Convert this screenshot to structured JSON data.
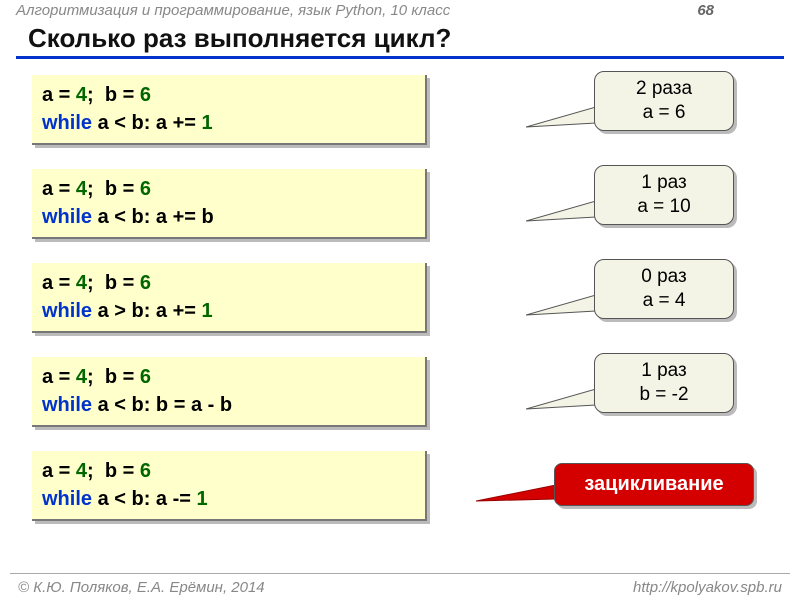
{
  "header": {
    "course": "Алгоритмизация и программирование, язык Python, 10 класс",
    "page": "68"
  },
  "title": "Сколько раз выполняется цикл?",
  "examples": [
    {
      "code": {
        "init_a": "a = ",
        "va": "4",
        "sep": ";  b = ",
        "vb": "6",
        "loop": "while ",
        "cond": "a < b: a += ",
        "tail_num": "1",
        "tail_txt": ""
      },
      "answer": {
        "line1": "2 раза",
        "line2": "a = 6",
        "style": "plain"
      }
    },
    {
      "code": {
        "init_a": "a = ",
        "va": "4",
        "sep": ";  b = ",
        "vb": "6",
        "loop": "while ",
        "cond": "a < b: a += b",
        "tail_num": "",
        "tail_txt": ""
      },
      "answer": {
        "line1": "1 раз",
        "line2": "a = 10",
        "style": "plain"
      }
    },
    {
      "code": {
        "init_a": "a = ",
        "va": "4",
        "sep": ";  b = ",
        "vb": "6",
        "loop": "while ",
        "cond": "a > b: a += ",
        "tail_num": "1",
        "tail_txt": ""
      },
      "answer": {
        "line1": "0 раз",
        "line2": "a = 4",
        "style": "plain"
      }
    },
    {
      "code": {
        "init_a": "a = ",
        "va": "4",
        "sep": ";  b = ",
        "vb": "6",
        "loop": "while ",
        "cond": "a < b: b = a - b",
        "tail_num": "",
        "tail_txt": ""
      },
      "answer": {
        "line1": "1 раз",
        "line2": "b = -2",
        "style": "plain"
      }
    },
    {
      "code": {
        "init_a": "a = ",
        "va": "4",
        "sep": ";  b = ",
        "vb": "6",
        "loop": "while ",
        "cond": "a < b: a -= ",
        "tail_num": "1",
        "tail_txt": ""
      },
      "answer": {
        "line1": "зацикливание",
        "line2": "",
        "style": "red"
      }
    }
  ],
  "footer": {
    "left": "К.Ю. Поляков, Е.А. Ерёмин, 2014",
    "right": "http://kpolyakov.spb.ru"
  }
}
